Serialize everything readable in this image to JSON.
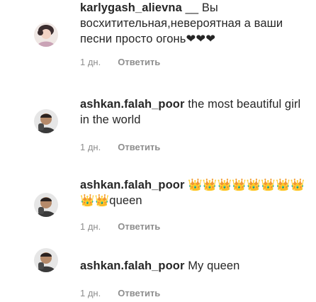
{
  "comments": [
    {
      "username": "karlygash_alievna",
      "text": "__ Вы восхитительная,невероятная а ваши песни просто огонь❤❤❤",
      "time": "1 дн.",
      "reply_label": "Ответить",
      "avatar_icon": "woman-avatar-icon"
    },
    {
      "username": "ashkan.falah_poor",
      "text": "the most beautiful girl in the world",
      "time": "1 дн.",
      "reply_label": "Ответить",
      "avatar_icon": "man-avatar-icon"
    },
    {
      "username": "ashkan.falah_poor",
      "text": "👑👑👑👑👑👑👑👑👑👑queen",
      "time": "1 дн.",
      "reply_label": "Ответить",
      "avatar_icon": "man-avatar-icon"
    },
    {
      "username": "ashkan.falah_poor",
      "text": "My queen",
      "time": "1 дн.",
      "reply_label": "Ответить",
      "avatar_icon": "man-avatar-icon"
    }
  ]
}
